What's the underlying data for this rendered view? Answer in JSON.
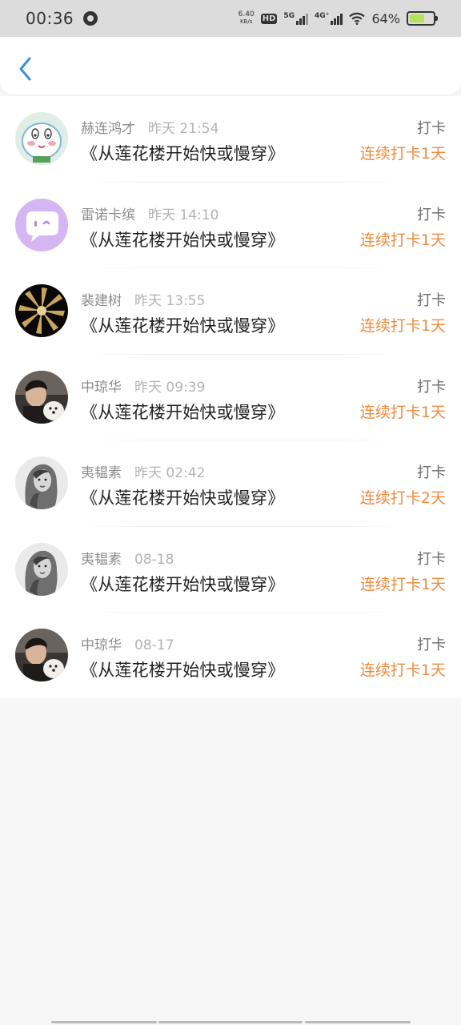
{
  "status_bar": {
    "time": "00:36",
    "net_speed_value": "6.40",
    "net_speed_unit": "KB/s",
    "hd_label": "HD",
    "sim2": "2",
    "net1": "5G",
    "net2": "4G⁺",
    "battery_percent": "64%",
    "battery_level": 0.64,
    "battery_color": "#b4e35b"
  },
  "header": {
    "back_icon": "chevron-left-icon",
    "accent": "#3a8fe0"
  },
  "colors": {
    "streak": "#f08a3c",
    "name": "#8d8d8d",
    "time": "#b3b3b3"
  },
  "checkins": [
    {
      "user": "赫连鸿才",
      "time": "昨天 21:54",
      "book": "《从莲花楼开始快或慢穿》",
      "action": "打卡",
      "streak": "连续打卡1天",
      "avatar": "cartoon-cat-avatar"
    },
    {
      "user": "雷诺卡缤",
      "time": "昨天 14:10",
      "book": "《从莲花楼开始快或慢穿》",
      "action": "打卡",
      "streak": "连续打卡1天",
      "avatar": "purple-chat-avatar"
    },
    {
      "user": "裴建树",
      "time": "昨天 13:55",
      "book": "《从莲花楼开始快或慢穿》",
      "action": "打卡",
      "streak": "连续打卡1天",
      "avatar": "gold-radial-avatar"
    },
    {
      "user": "中琼华",
      "time": "昨天 09:39",
      "book": "《从莲花楼开始快或慢穿》",
      "action": "打卡",
      "streak": "连续打卡1天",
      "avatar": "man-with-dog-avatar"
    },
    {
      "user": "夷韫素",
      "time": "昨天 02:42",
      "book": "《从莲花楼开始快或慢穿》",
      "action": "打卡",
      "streak": "连续打卡2天",
      "avatar": "woman-portrait-avatar"
    },
    {
      "user": "夷韫素",
      "time": "08-18",
      "book": "《从莲花楼开始快或慢穿》",
      "action": "打卡",
      "streak": "连续打卡1天",
      "avatar": "woman-portrait-avatar"
    },
    {
      "user": "中琼华",
      "time": "08-17",
      "book": "《从莲花楼开始快或慢穿》",
      "action": "打卡",
      "streak": "连续打卡1天",
      "avatar": "man-with-dog-avatar"
    }
  ]
}
